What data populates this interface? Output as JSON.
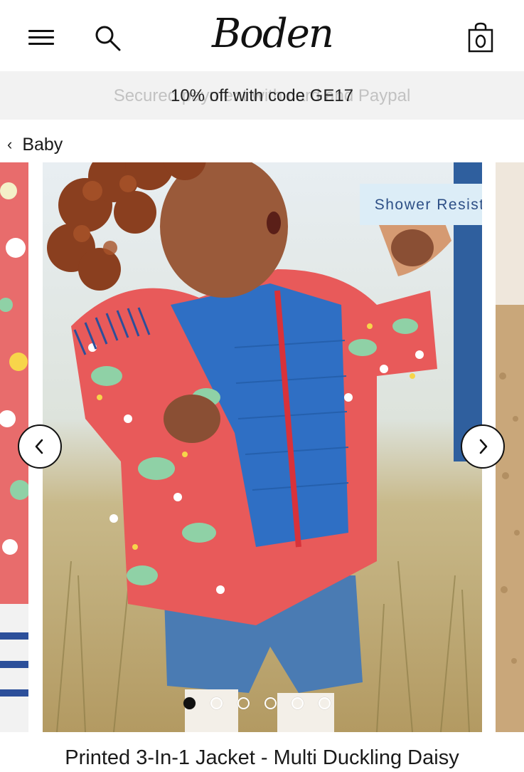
{
  "header": {
    "logo_text": "Boden",
    "menu_icon": "hamburger-menu-icon",
    "search_icon": "search-icon",
    "bag_icon": "shopping-bag-icon"
  },
  "promo": {
    "background_text": "Secured payment with card and Paypal",
    "text": "10% off with code GE17"
  },
  "breadcrumb": {
    "label": "Baby"
  },
  "carousel": {
    "badge": "Shower Resistant",
    "slide_count": 6,
    "active_slide": 1,
    "prev_icon": "chevron-left-icon",
    "next_icon": "chevron-right-icon"
  },
  "product": {
    "title": "Printed 3-In-1 Jacket - Multi Duckling Daisy"
  },
  "colors": {
    "promo_bg": "#f2f2f2",
    "badge_bg": "#dcedf7",
    "badge_text": "#2d4f86",
    "jacket_red": "#e85a5a",
    "gilet_blue": "#2f6fc4"
  }
}
